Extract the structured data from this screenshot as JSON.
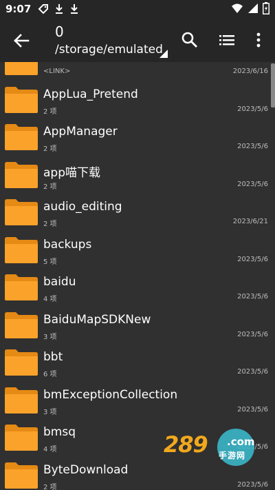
{
  "status": {
    "time": "9:07"
  },
  "toolbar": {
    "title": "0",
    "path": "/storage/emulated"
  },
  "colors": {
    "background": "#303030",
    "toolbar": "#262626",
    "folder_front": "#FBA22A",
    "folder_back": "#E58A14",
    "meta_text": "#BDBDBD"
  },
  "items": [
    {
      "name": "",
      "meta": "<LINK>",
      "date": "2023/6/16"
    },
    {
      "name": "AppLua_Pretend",
      "meta": "2 项",
      "date": "2023/5/6"
    },
    {
      "name": "AppManager",
      "meta": "2 项",
      "date": "2023/5/6"
    },
    {
      "name": "app喵下载",
      "meta": "2 项",
      "date": "2023/5/6"
    },
    {
      "name": "audio_editing",
      "meta": "2 项",
      "date": "2023/6/21"
    },
    {
      "name": "backups",
      "meta": "5 项",
      "date": "2023/5/6"
    },
    {
      "name": "baidu",
      "meta": "4 项",
      "date": "2023/5/6"
    },
    {
      "name": "BaiduMapSDKNew",
      "meta": "3 项",
      "date": "2023/5/6"
    },
    {
      "name": "bbt",
      "meta": "6 项",
      "date": "2023/5/6"
    },
    {
      "name": "bmExceptionCollection",
      "meta": "3 项",
      "date": "2023/5/6"
    },
    {
      "name": "bmsq",
      "meta": "4 项",
      "date": "2023/5/6"
    },
    {
      "name": "ByteDownload",
      "meta": "2 项",
      "date": "2023/5/6"
    }
  ],
  "watermark": {
    "brand": "289",
    "domain": ".com",
    "tagline": "手游网"
  }
}
